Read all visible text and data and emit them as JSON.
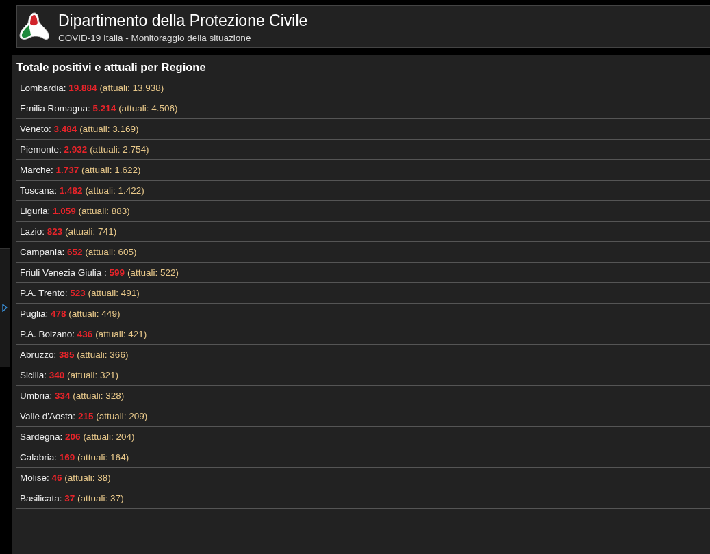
{
  "header": {
    "title": "Dipartimento della Protezione Civile",
    "subtitle": "COVID-19 Italia - Monitoraggio della situazione"
  },
  "panel": {
    "title": "Totale positivi e attuali per Regione",
    "rows": [
      {
        "region": "Lombardia:",
        "total": "19.884",
        "current": "(attuali: 13.938)"
      },
      {
        "region": "Emilia Romagna:",
        "total": "5.214",
        "current": "(attuali: 4.506)"
      },
      {
        "region": "Veneto:",
        "total": "3.484",
        "current": "(attuali: 3.169)"
      },
      {
        "region": "Piemonte:",
        "total": "2.932",
        "current": "(attuali: 2.754)"
      },
      {
        "region": "Marche:",
        "total": "1.737",
        "current": "(attuali: 1.622)"
      },
      {
        "region": "Toscana:",
        "total": "1.482",
        "current": "(attuali: 1.422)"
      },
      {
        "region": "Liguria:",
        "total": "1.059",
        "current": "(attuali: 883)"
      },
      {
        "region": "Lazio:",
        "total": "823",
        "current": "(attuali: 741)"
      },
      {
        "region": "Campania:",
        "total": "652",
        "current": "(attuali: 605)"
      },
      {
        "region": "Friuli Venezia Giulia :",
        "total": "599",
        "current": "(attuali: 522)"
      },
      {
        "region": "P.A. Trento:",
        "total": "523",
        "current": "(attuali: 491)"
      },
      {
        "region": "Puglia:",
        "total": "478",
        "current": "(attuali: 449)"
      },
      {
        "region": "P.A. Bolzano:",
        "total": "436",
        "current": "(attuali: 421)"
      },
      {
        "region": "Abruzzo:",
        "total": "385",
        "current": "(attuali: 366)"
      },
      {
        "region": "Sicilia:",
        "total": "340",
        "current": "(attuali: 321)"
      },
      {
        "region": "Umbria:",
        "total": "334",
        "current": "(attuali: 328)"
      },
      {
        "region": "Valle d'Aosta:",
        "total": "215",
        "current": "(attuali: 209)"
      },
      {
        "region": "Sardegna:",
        "total": "206",
        "current": "(attuali: 204)"
      },
      {
        "region": "Calabria:",
        "total": "169",
        "current": "(attuali: 164)"
      },
      {
        "region": "Molise:",
        "total": "46",
        "current": "(attuali: 38)"
      },
      {
        "region": "Basilicata:",
        "total": "37",
        "current": "(attuali: 37)"
      }
    ]
  }
}
